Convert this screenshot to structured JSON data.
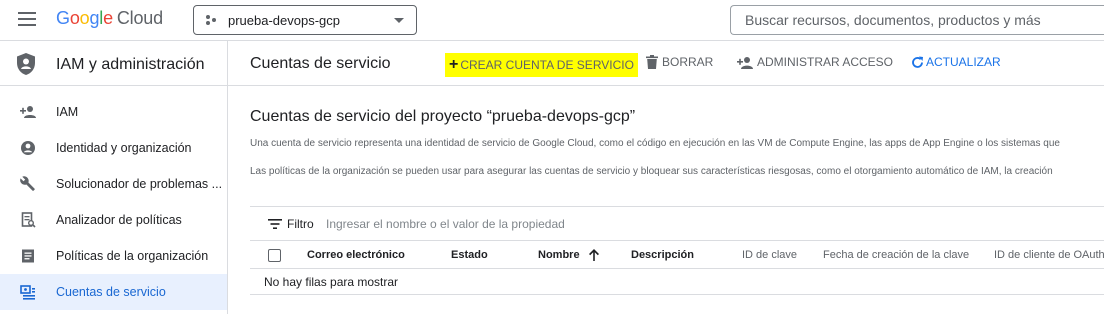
{
  "topbar": {
    "logo_letters": [
      "G",
      "o",
      "o",
      "g",
      "l",
      "e"
    ],
    "logo_suffix": "Cloud",
    "project_name": "prueba-devops-gcp",
    "search_placeholder": "Buscar recursos, documentos, productos y más"
  },
  "sidebar": {
    "title": "IAM y administración",
    "items": [
      {
        "label": "IAM",
        "icon": "person-add-icon"
      },
      {
        "label": "Identidad y organización",
        "icon": "account-circle-icon"
      },
      {
        "label": "Solucionador de problemas ...",
        "icon": "wrench-icon"
      },
      {
        "label": "Analizador de políticas",
        "icon": "document-search-icon"
      },
      {
        "label": "Políticas de la organización",
        "icon": "article-icon"
      },
      {
        "label": "Cuentas de servicio",
        "icon": "service-account-icon",
        "active": true
      }
    ]
  },
  "header": {
    "title": "Cuentas de servicio",
    "create_label": "CREAR CUENTA DE SERVICIO",
    "delete_label": "BORRAR",
    "manage_label": "ADMINISTRAR ACCESO",
    "refresh_label": "ACTUALIZAR"
  },
  "content": {
    "title": "Cuentas de servicio del proyecto “prueba-devops-gcp”",
    "desc1": "Una cuenta de servicio representa una identidad de servicio de Google Cloud, como el código en ejecución en las VM de Compute Engine, las apps de App Engine o los sistemas que",
    "desc2": "Las políticas de la organización se pueden usar para asegurar las cuentas de servicio y bloquear sus características riesgosas, como el otorgamiento automático de IAM, la creación"
  },
  "filter": {
    "label": "Filtro",
    "placeholder": "Ingresar el nombre o el valor de la propiedad"
  },
  "table": {
    "columns": [
      "Correo electrónico",
      "Estado",
      "Nombre",
      "Descripción",
      "ID de clave",
      "Fecha de creación de la clave",
      "ID de cliente de OAuth"
    ],
    "sorted_column": "Nombre",
    "sort_direction": "ascending",
    "empty_message": "No hay filas para mostrar"
  },
  "colors": {
    "accent": "#1a73e8",
    "highlight": "#ffff00",
    "active_bg": "#e8f0fe"
  }
}
